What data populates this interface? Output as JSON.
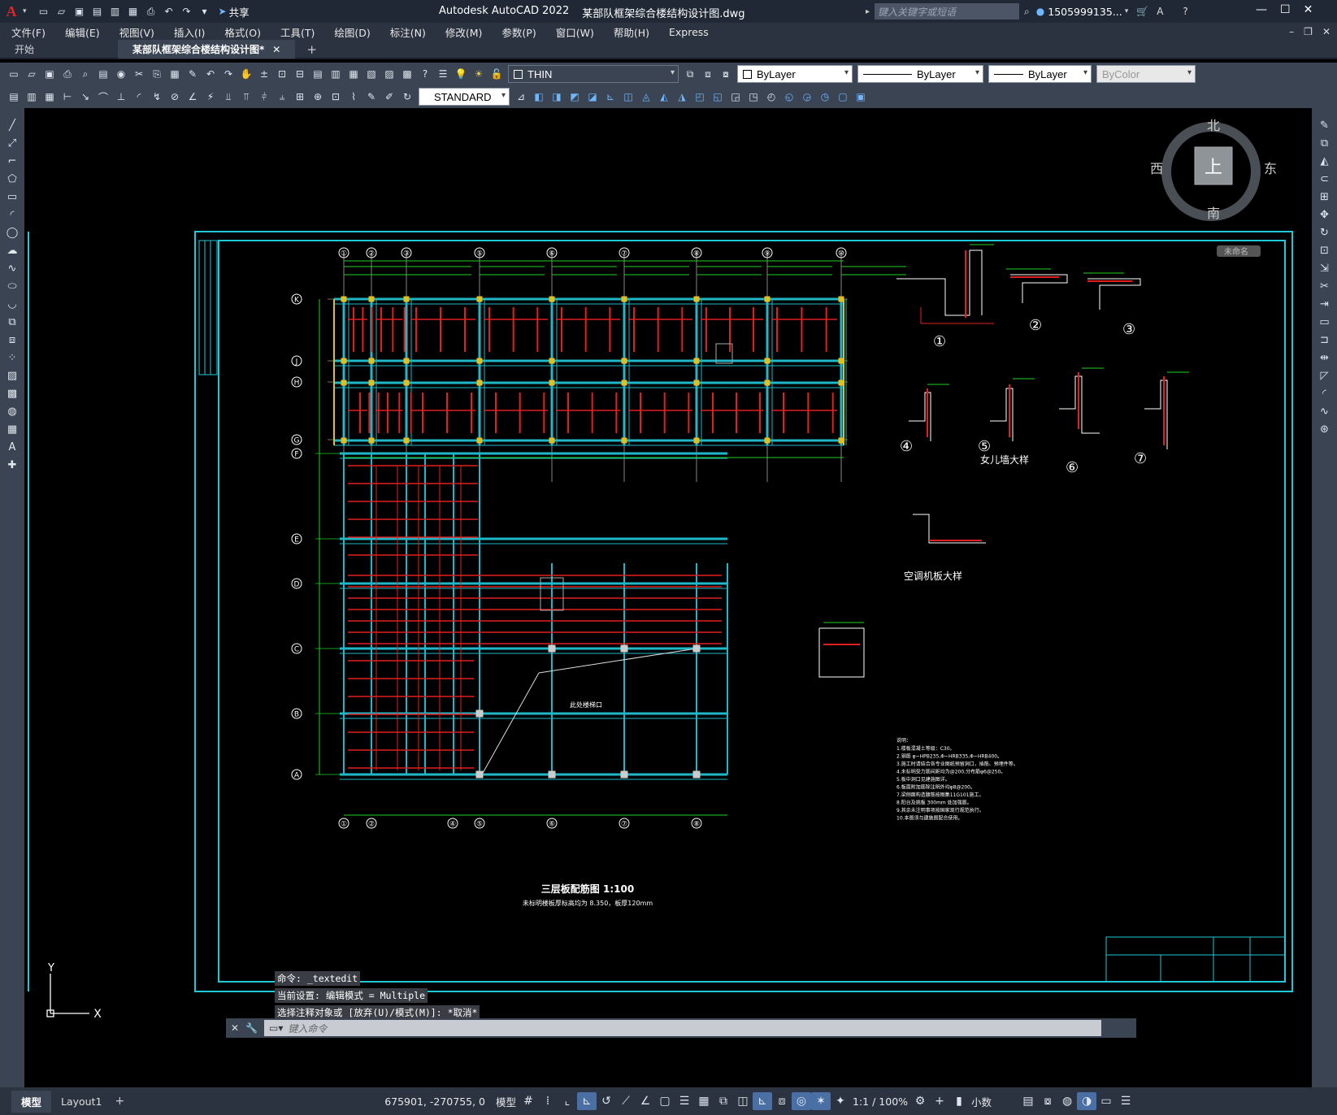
{
  "app": {
    "title": "Autodesk AutoCAD 2022",
    "doc_title": "某部队框架综合楼结构设计图.dwg",
    "share_label": "共享",
    "search_placeholder": "键入关键字或短语",
    "user": "1505999135..."
  },
  "menu": [
    "文件(F)",
    "编辑(E)",
    "视图(V)",
    "插入(I)",
    "格式(O)",
    "工具(T)",
    "绘图(D)",
    "标注(N)",
    "修改(M)",
    "参数(P)",
    "窗口(W)",
    "帮助(H)",
    "Express"
  ],
  "tabs": {
    "start": "开始",
    "doc": "某部队框架综合楼结构设计图*"
  },
  "toolbar": {
    "layer": "THIN",
    "color": "ByLayer",
    "linetype": "ByLayer",
    "lineweight": "ByLayer",
    "plotstyle": "ByColor",
    "textstyle": "STANDARD"
  },
  "viewcube": {
    "north": "北",
    "south": "南",
    "east": "东",
    "west": "西",
    "top": "上",
    "wcs": "未命名"
  },
  "drawing": {
    "plan_title": "三层板配筋图  1:100",
    "plan_subtitle": "未标明楼板厚标高均为 8.350，板厚120mm",
    "hole_label": "此处楼梯口",
    "detail1": "①",
    "detail2": "②",
    "detail3": "③",
    "detail4": "④",
    "detail5": "⑤",
    "detail6": "⑥",
    "detail7": "⑦",
    "parapet_label": "女儿墙大样",
    "ac_label": "空调机板大样",
    "notes_title": "说明：",
    "notes": [
      "1.楼板混凝土等级：C30。",
      "2.钢筋 φ~HPB235,Φ~HRB335,Φ~HRB400。",
      "3.施工时请结合各专业图纸预留洞口，插筋、预埋件等。",
      "4.未标明受力筋间距均为@200,分布筋φ6@250。",
      "5.板中洞口见建施图详。",
      "6.板面附加筋除注明外均φ8@200。",
      "7.梁侧面构造腰筋按图集11G101施工。",
      "8.阳台及挑板 300mm 处加强筋。",
      "9.其余未注明事项按国家现行规范执行。",
      "10.本图须与建施图配合使用。"
    ],
    "axis_top": [
      "①",
      "②",
      "③",
      "⑤",
      "⑥",
      "⑦",
      "⑧",
      "⑨",
      "⑩"
    ],
    "axis_bottom": [
      "①",
      "②",
      "④",
      "⑤",
      "⑥",
      "⑦",
      "⑧"
    ],
    "axis_left": [
      "K",
      "J",
      "H",
      "G",
      "F",
      "E",
      "D",
      "C",
      "B",
      "A"
    ]
  },
  "command": {
    "history": [
      "命令: _textedit",
      "当前设置: 编辑模式 = Multiple",
      "选择注释对象或 [放弃(U)/模式(M)]: *取消*"
    ],
    "placeholder": "键入命令"
  },
  "ucs": {
    "x": "X",
    "y": "Y"
  },
  "status": {
    "model_tab": "模型",
    "layout_tab": "Layout1",
    "coords": "675901, -270755, 0",
    "mode": "模型",
    "scale": "1:1 / 100%",
    "units": "小数"
  }
}
